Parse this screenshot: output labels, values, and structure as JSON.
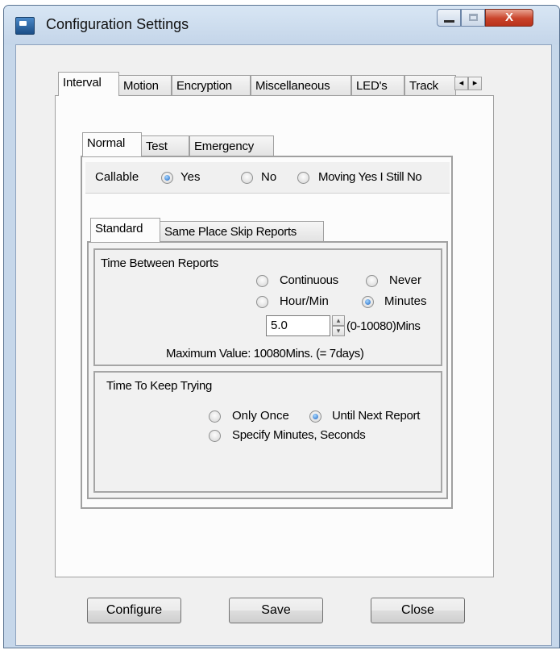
{
  "window": {
    "title": "Configuration Settings",
    "close_glyph": "X"
  },
  "main_tabs": [
    "Interval",
    "Motion",
    "Encryption",
    "Miscellaneous",
    "LED's",
    "Track"
  ],
  "sub_tabs": [
    "Normal",
    "Test",
    "Emergency"
  ],
  "callable": {
    "label": "Callable",
    "options": [
      {
        "label": "Yes",
        "checked": true
      },
      {
        "label": "No",
        "checked": false
      },
      {
        "label": "Moving Yes I Still No",
        "checked": false
      }
    ]
  },
  "report_tabs": [
    "Standard",
    "Same Place Skip Reports"
  ],
  "time_between_reports": {
    "title": "Time Between Reports",
    "options": [
      {
        "label": "Continuous",
        "checked": false
      },
      {
        "label": "Never",
        "checked": false
      },
      {
        "label": "Hour/Min",
        "checked": false
      },
      {
        "label": "Minutes",
        "checked": true
      }
    ],
    "value": "5.0",
    "range_label": "(0-10080)Mins",
    "max_note": "Maximum Value: 10080Mins. (= 7days)"
  },
  "time_to_keep_trying": {
    "title": "Time To Keep Trying",
    "options": [
      {
        "label": "Only Once",
        "checked": false
      },
      {
        "label": "Until Next Report",
        "checked": true
      },
      {
        "label": "Specify Minutes, Seconds",
        "checked": false
      }
    ]
  },
  "buttons": {
    "configure": "Configure",
    "save": "Save",
    "close": "Close"
  },
  "icons": {
    "scroll_left": "◂",
    "scroll_right": "▸",
    "spin_up": "▴",
    "spin_down": "▾"
  },
  "colors": {
    "radio_selected": "#1b64c2",
    "close_button": "#c9432a"
  }
}
